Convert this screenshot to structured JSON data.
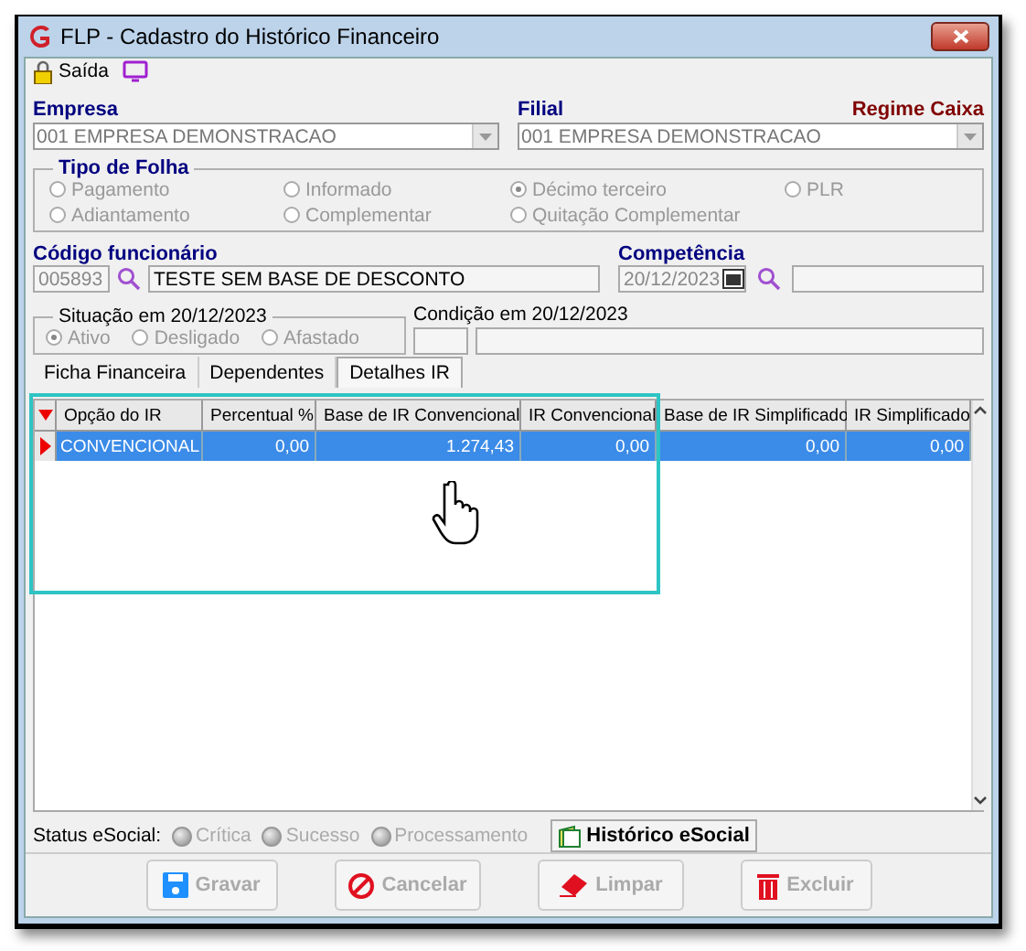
{
  "window": {
    "title": "FLP - Cadastro do Histórico Financeiro"
  },
  "toolbar": {
    "exit": "Saída"
  },
  "empresa": {
    "label": "Empresa",
    "value": "001 EMPRESA DEMONSTRACAO"
  },
  "filial": {
    "label": "Filial",
    "value": "001 EMPRESA DEMONSTRACAO",
    "regime": "Regime Caixa"
  },
  "tipo_folha": {
    "title": "Tipo de Folha",
    "options": [
      {
        "label": "Pagamento",
        "selected": false
      },
      {
        "label": "Informado",
        "selected": false
      },
      {
        "label": "Décimo terceiro",
        "selected": true
      },
      {
        "label": "PLR",
        "selected": false
      },
      {
        "label": "Adiantamento",
        "selected": false
      },
      {
        "label": "Complementar",
        "selected": false
      },
      {
        "label": "Quitação Complementar",
        "selected": false
      }
    ]
  },
  "funcionario": {
    "label": "Código funcionário",
    "code": "005893",
    "name": "TESTE SEM BASE DE DESCONTO"
  },
  "competencia": {
    "label": "Competência",
    "value": "20/12/2023"
  },
  "situacao": {
    "title": "Situação em 20/12/2023",
    "options": [
      {
        "label": "Ativo",
        "selected": true
      },
      {
        "label": "Desligado",
        "selected": false
      },
      {
        "label": "Afastado",
        "selected": false
      }
    ]
  },
  "condicao": {
    "label": "Condição em 20/12/2023"
  },
  "tabs": [
    {
      "label": "Ficha Financeira",
      "selected": false
    },
    {
      "label": "Dependentes",
      "selected": false
    },
    {
      "label": "Detalhes IR",
      "selected": true
    }
  ],
  "table": {
    "columns": [
      "Opção do IR",
      "Percentual %",
      "Base de IR Convencional",
      "IR Convencional",
      "Base de IR Simplificado",
      "IR Simplificado"
    ],
    "rows": [
      {
        "selected": true,
        "cells": [
          "CONVENCIONAL",
          "0,00",
          "1.274,43",
          "0,00",
          "0,00",
          "0,00"
        ]
      }
    ]
  },
  "status_bar": {
    "label": "Status eSocial:",
    "indicators": [
      "Crítica",
      "Sucesso",
      "Processamento"
    ],
    "history_button": "Histórico eSocial"
  },
  "buttons": [
    {
      "label": "Gravar",
      "kind": "save"
    },
    {
      "label": "Cancelar",
      "kind": "cancel"
    },
    {
      "label": "Limpar",
      "kind": "clear"
    },
    {
      "label": "Excluir",
      "kind": "delete"
    }
  ]
}
